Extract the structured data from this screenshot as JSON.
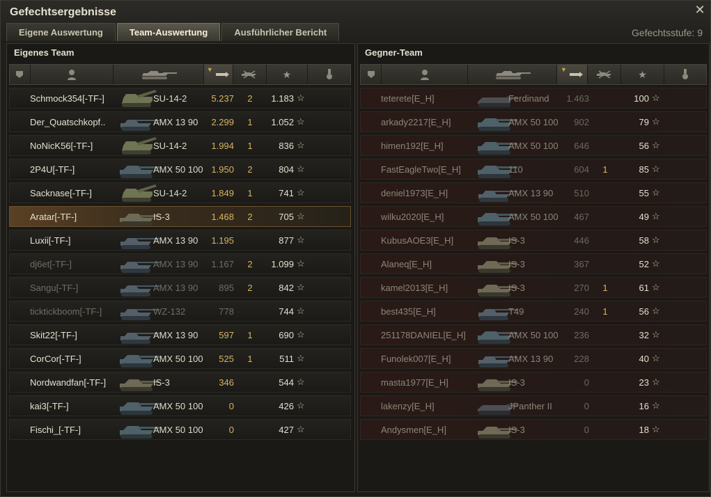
{
  "window": {
    "title": "Gefechtsergebnisse",
    "close_glyph": "✕"
  },
  "tabs": [
    {
      "label": "Eigene Auswertung",
      "active": false
    },
    {
      "label": "Team-Auswertung",
      "active": true
    },
    {
      "label": "Ausführlicher Bericht",
      "active": false
    }
  ],
  "battle_level": "Gefechtsstufe: 9",
  "own_team": {
    "title": "Eigenes Team",
    "header_icons": [
      "platoon-icon",
      "player-icon",
      "tank-icon",
      "damage-icon",
      "kills-icon",
      "xp-star-icon",
      "medal-icon"
    ],
    "rows": [
      {
        "name": "Schmock354[-TF-]",
        "vehicle": "SU-14-2",
        "damage": "5.237",
        "kills": "2",
        "xp": "1.183",
        "tank_type": "spg",
        "state": "alive"
      },
      {
        "name": "Der_Quatschkopf..",
        "vehicle": "AMX 13 90",
        "damage": "2.299",
        "kills": "1",
        "xp": "1.052",
        "tank_type": "light",
        "state": "alive"
      },
      {
        "name": "NoNicK56[-TF-]",
        "vehicle": "SU-14-2",
        "damage": "1.994",
        "kills": "1",
        "xp": "836",
        "tank_type": "spg",
        "state": "alive"
      },
      {
        "name": "2P4U[-TF-]",
        "vehicle": "AMX 50 100",
        "damage": "1.950",
        "kills": "2",
        "xp": "804",
        "tank_type": "heavy",
        "state": "alive"
      },
      {
        "name": "Sacknase[-TF-]",
        "vehicle": "SU-14-2",
        "damage": "1.849",
        "kills": "1",
        "xp": "741",
        "tank_type": "spg",
        "state": "alive"
      },
      {
        "name": "Aratar[-TF-]",
        "vehicle": "IS-3",
        "damage": "1.468",
        "kills": "2",
        "xp": "705",
        "tank_type": "is3",
        "state": "me"
      },
      {
        "name": "Luxii[-TF-]",
        "vehicle": "AMX 13 90",
        "damage": "1.195",
        "kills": "",
        "xp": "877",
        "tank_type": "light",
        "state": "alive"
      },
      {
        "name": "dj6et[-TF-]",
        "vehicle": "AMX 13 90",
        "damage": "1.167",
        "kills": "2",
        "xp": "1.099",
        "tank_type": "light",
        "state": "dead"
      },
      {
        "name": "Sangu[-TF-]",
        "vehicle": "AMX 13 90",
        "damage": "895",
        "kills": "2",
        "xp": "842",
        "tank_type": "light",
        "state": "dead"
      },
      {
        "name": "ticktickboom[-TF-]",
        "vehicle": "WZ-132",
        "damage": "778",
        "kills": "",
        "xp": "744",
        "tank_type": "light",
        "state": "dead"
      },
      {
        "name": "Skit22[-TF-]",
        "vehicle": "AMX 13 90",
        "damage": "597",
        "kills": "1",
        "xp": "690",
        "tank_type": "light",
        "state": "alive"
      },
      {
        "name": "CorCor[-TF-]",
        "vehicle": "AMX 50 100",
        "damage": "525",
        "kills": "1",
        "xp": "511",
        "tank_type": "heavy",
        "state": "alive"
      },
      {
        "name": "Nordwandfan[-TF-]",
        "vehicle": "IS-3",
        "damage": "346",
        "kills": "",
        "xp": "544",
        "tank_type": "is3",
        "state": "alive"
      },
      {
        "name": "kai3[-TF-]",
        "vehicle": "AMX 50 100",
        "damage": "0",
        "kills": "",
        "xp": "426",
        "tank_type": "heavy",
        "state": "alive"
      },
      {
        "name": "Fischi_[-TF-]",
        "vehicle": "AMX 50 100",
        "damage": "0",
        "kills": "",
        "xp": "427",
        "tank_type": "heavy",
        "state": "alive"
      }
    ]
  },
  "enemy_team": {
    "title": "Gegner-Team",
    "header_icons": [
      "platoon-icon",
      "player-icon",
      "tank-icon",
      "damage-icon",
      "kills-icon",
      "xp-star-icon",
      "medal-icon"
    ],
    "rows": [
      {
        "name": "teterete[E_H]",
        "vehicle": "Ferdinand",
        "damage": "1.463",
        "kills": "",
        "xp": "100",
        "tank_type": "td"
      },
      {
        "name": "arkady2217[E_H]",
        "vehicle": "AMX 50 100",
        "damage": "902",
        "kills": "",
        "xp": "79",
        "tank_type": "heavy"
      },
      {
        "name": "himen192[E_H]",
        "vehicle": "AMX 50 100",
        "damage": "646",
        "kills": "",
        "xp": "56",
        "tank_type": "heavy"
      },
      {
        "name": "FastEagleTwo[E_H]",
        "vehicle": "110",
        "damage": "604",
        "kills": "1",
        "xp": "85",
        "tank_type": "heavy"
      },
      {
        "name": "deniel1973[E_H]",
        "vehicle": "AMX 13 90",
        "damage": "510",
        "kills": "",
        "xp": "55",
        "tank_type": "light"
      },
      {
        "name": "wilku2020[E_H]",
        "vehicle": "AMX 50 100",
        "damage": "467",
        "kills": "",
        "xp": "49",
        "tank_type": "heavy"
      },
      {
        "name": "KubusAOE3[E_H]",
        "vehicle": "IS-3",
        "damage": "446",
        "kills": "",
        "xp": "58",
        "tank_type": "is3"
      },
      {
        "name": "Alaneq[E_H]",
        "vehicle": "IS-3",
        "damage": "367",
        "kills": "",
        "xp": "52",
        "tank_type": "is3"
      },
      {
        "name": "kamel2013[E_H]",
        "vehicle": "IS-3",
        "damage": "270",
        "kills": "1",
        "xp": "61",
        "tank_type": "is3"
      },
      {
        "name": "best435[E_H]",
        "vehicle": "T49",
        "damage": "240",
        "kills": "1",
        "xp": "56",
        "tank_type": "light"
      },
      {
        "name": "251178DANIEL[E_H]",
        "vehicle": "AMX 50 100",
        "damage": "236",
        "kills": "",
        "xp": "32",
        "tank_type": "heavy"
      },
      {
        "name": "Funolek007[E_H]",
        "vehicle": "AMX 13 90",
        "damage": "228",
        "kills": "",
        "xp": "40",
        "tank_type": "light"
      },
      {
        "name": "masta1977[E_H]",
        "vehicle": "IS-3",
        "damage": "0",
        "kills": "",
        "xp": "23",
        "tank_type": "is3"
      },
      {
        "name": "lakenzy[E_H]",
        "vehicle": "JPanther II",
        "damage": "0",
        "kills": "",
        "xp": "16",
        "tank_type": "td"
      },
      {
        "name": "Andysmen[E_H]",
        "vehicle": "IS-3",
        "damage": "0",
        "kills": "",
        "xp": "18",
        "tank_type": "is3"
      }
    ]
  },
  "star_glyph": "☆",
  "colors": {
    "accent": "#d8b460",
    "own_row": "#23221e",
    "enemy_row": "#2a1a17",
    "highlight_row": "#5a4024"
  }
}
